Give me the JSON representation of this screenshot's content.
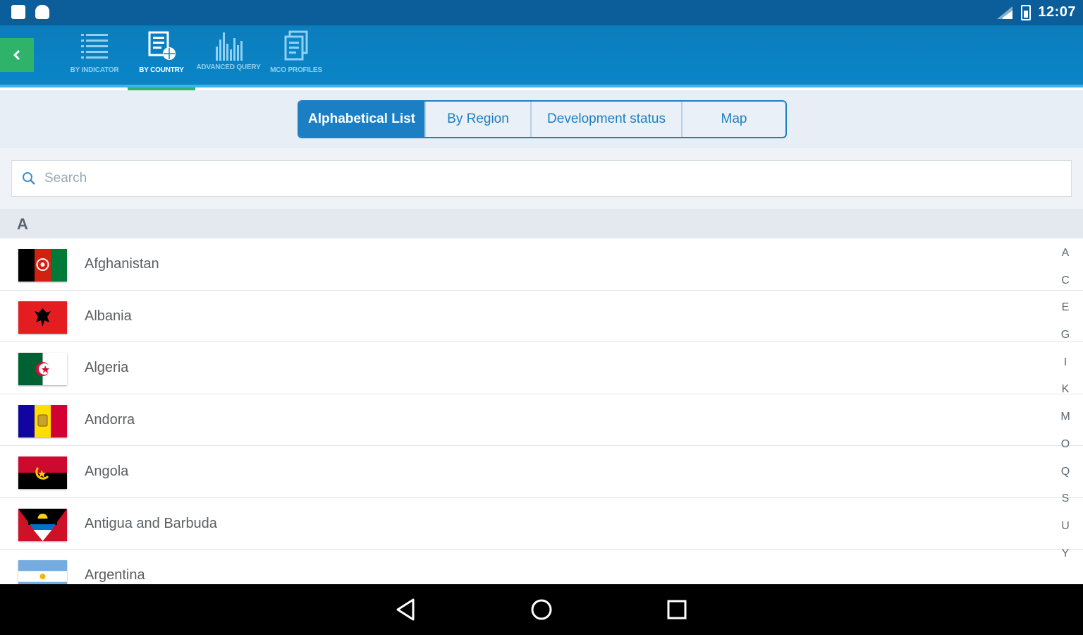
{
  "status_bar": {
    "time": "12:07"
  },
  "colors": {
    "status_bar": "#0b5e99",
    "toolbar": "#0a85c7",
    "accent_green": "#2fb36a",
    "segment_blue": "#1d7fc3"
  },
  "toolbar": {
    "back_icon": "chevron-left-icon",
    "tabs": [
      {
        "label": "BY INDICATOR",
        "icon": "list-icon",
        "active": false
      },
      {
        "label": "BY COUNTRY",
        "icon": "country-document-icon",
        "active": true
      },
      {
        "label": "ADVANCED QUERY",
        "icon": "bar-chart-icon",
        "active": false
      },
      {
        "label": "MCO PROFILES",
        "icon": "documents-icon",
        "active": false
      }
    ]
  },
  "filter": {
    "segments": [
      "Alphabetical List",
      "By Region",
      "Development status",
      "Map"
    ],
    "active_segment": "Alphabetical List"
  },
  "search": {
    "placeholder": "Search"
  },
  "list": {
    "section": "A",
    "countries": [
      {
        "name": "Afghanistan",
        "flag": "afghanistan-flag"
      },
      {
        "name": "Albania",
        "flag": "albania-flag"
      },
      {
        "name": "Algeria",
        "flag": "algeria-flag"
      },
      {
        "name": "Andorra",
        "flag": "andorra-flag"
      },
      {
        "name": "Angola",
        "flag": "angola-flag"
      },
      {
        "name": "Antigua and Barbuda",
        "flag": "antigua-flag"
      },
      {
        "name": "Argentina",
        "flag": "argentina-flag"
      }
    ]
  },
  "index_letters": [
    "A",
    "C",
    "E",
    "G",
    "I",
    "K",
    "M",
    "O",
    "Q",
    "S",
    "U",
    "Y"
  ]
}
